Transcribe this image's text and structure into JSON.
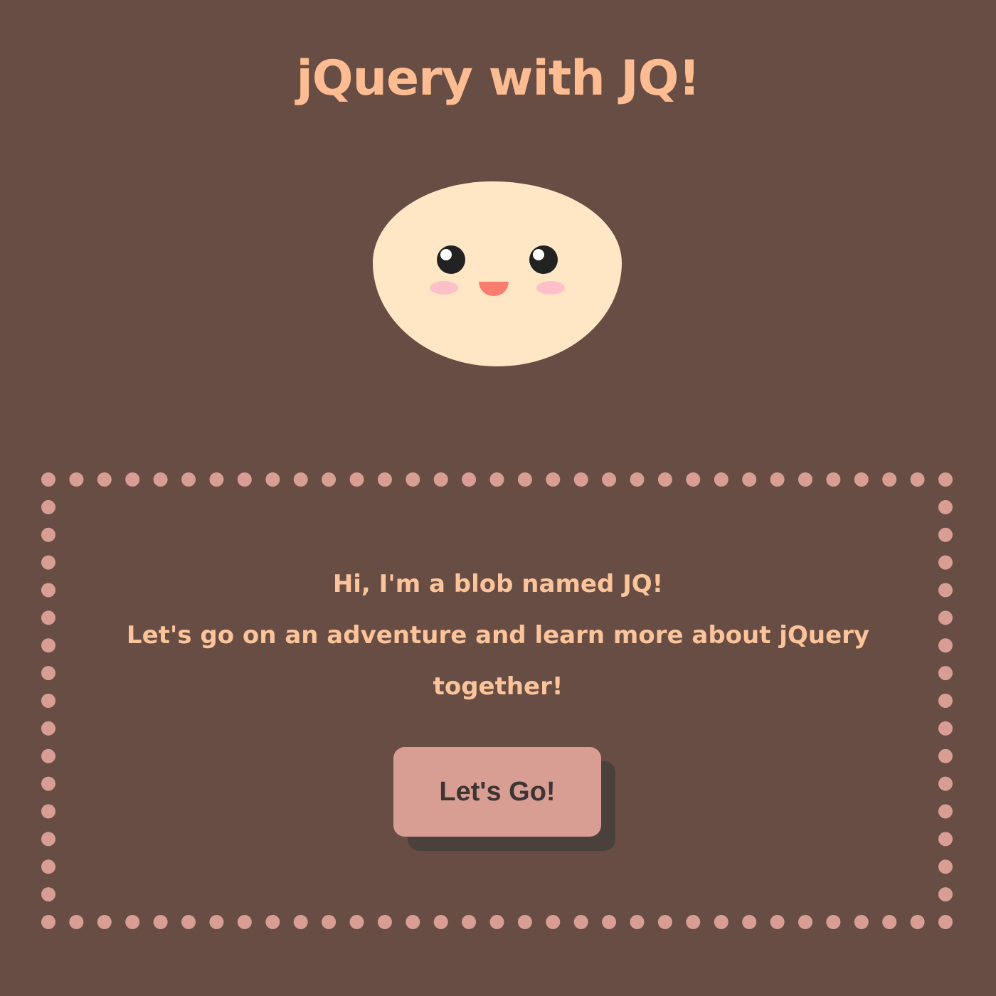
{
  "page": {
    "title": "jQuery with JQ!"
  },
  "mascot": {
    "name": "blob-mascot"
  },
  "intro": {
    "greeting": "Hi, I'm a blob named JQ!",
    "invitation": "Let's go on an adventure and learn more about jQuery together!"
  },
  "actions": {
    "start_label": "Let's Go!"
  },
  "colors": {
    "background": "#674d44",
    "title_text": "#fdbc91",
    "intro_text": "#fcc49a",
    "blob_body": "#ffe7c6",
    "eye": "#222222",
    "mouth": "#fa7d6f",
    "cheek": "#fdc0c8",
    "dots": "#d99e93",
    "button_face": "#d99e93",
    "button_shadow": "#4a413d",
    "button_text": "#3d3533"
  }
}
